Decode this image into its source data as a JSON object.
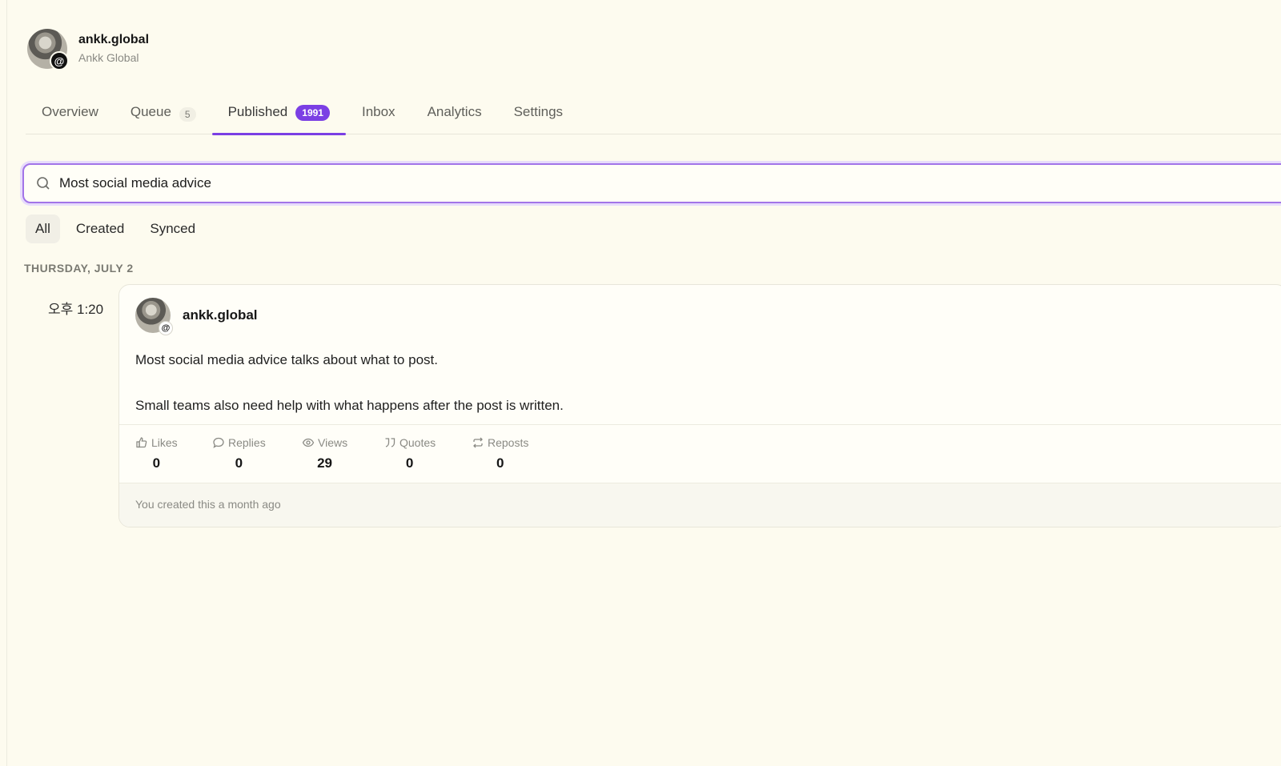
{
  "profile": {
    "handle": "ankk.global",
    "display_name": "Ankk Global",
    "badge_icon": "threads-icon"
  },
  "tabs": [
    {
      "label": "Overview"
    },
    {
      "label": "Queue",
      "count": "5"
    },
    {
      "label": "Published",
      "count": "1991",
      "active": true
    },
    {
      "label": "Inbox"
    },
    {
      "label": "Analytics"
    },
    {
      "label": "Settings"
    }
  ],
  "search": {
    "value": "Most social media advice",
    "icon": "search-icon"
  },
  "filters": [
    {
      "label": "All",
      "active": true
    },
    {
      "label": "Created"
    },
    {
      "label": "Synced"
    }
  ],
  "date_heading": "THURSDAY, JULY 2",
  "post": {
    "time": "오후 1:20",
    "handle": "ankk.global",
    "paragraphs": [
      "Most social media advice talks about what to post.",
      "Small teams also need help with what happens after the post is written."
    ],
    "metrics": [
      {
        "label": "Likes",
        "value": "0",
        "icon": "thumbs-up-icon"
      },
      {
        "label": "Replies",
        "value": "0",
        "icon": "speech-bubble-icon"
      },
      {
        "label": "Views",
        "value": "29",
        "icon": "eye-icon"
      },
      {
        "label": "Quotes",
        "value": "0",
        "icon": "quote-icon"
      },
      {
        "label": "Reposts",
        "value": "0",
        "icon": "repost-icon"
      }
    ],
    "footer": "You created this a month ago"
  },
  "colors": {
    "background": "#fdfbef",
    "accent": "#7b3fe4"
  }
}
